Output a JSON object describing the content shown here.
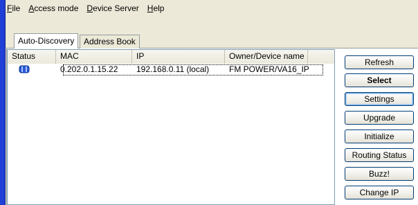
{
  "menu": {
    "items": [
      {
        "label": "File",
        "u": "F",
        "rest": "ile"
      },
      {
        "label": "Access mode",
        "u": "A",
        "rest": "ccess mode"
      },
      {
        "label": "Device Server",
        "u": "D",
        "rest": "evice Server"
      },
      {
        "label": "Help",
        "u": "H",
        "rest": "elp"
      }
    ]
  },
  "tabs": [
    {
      "label": "Auto-Discovery",
      "active": true
    },
    {
      "label": "Address Book",
      "active": false
    }
  ],
  "list": {
    "columns": [
      "Status",
      "MAC",
      "IP",
      "Owner/Device name"
    ],
    "rows": [
      {
        "status_icon": "connected-device-icon",
        "mac": "0.202.0.1.15.22",
        "ip": "192.168.0.11 (local)",
        "owner": "FM POWER/VA16_IP"
      }
    ]
  },
  "buttons": {
    "refresh": "Refresh",
    "select": "Select",
    "settings": "Settings",
    "upgrade": "Upgrade",
    "initialize": "Initialize",
    "routing_status": "Routing Status",
    "buzz": "Buzz!",
    "change_ip": "Change IP"
  },
  "colors": {
    "left_bar": "#1f3fd6",
    "button_border": "#003c74",
    "status_icon": "#2a5bd7"
  }
}
